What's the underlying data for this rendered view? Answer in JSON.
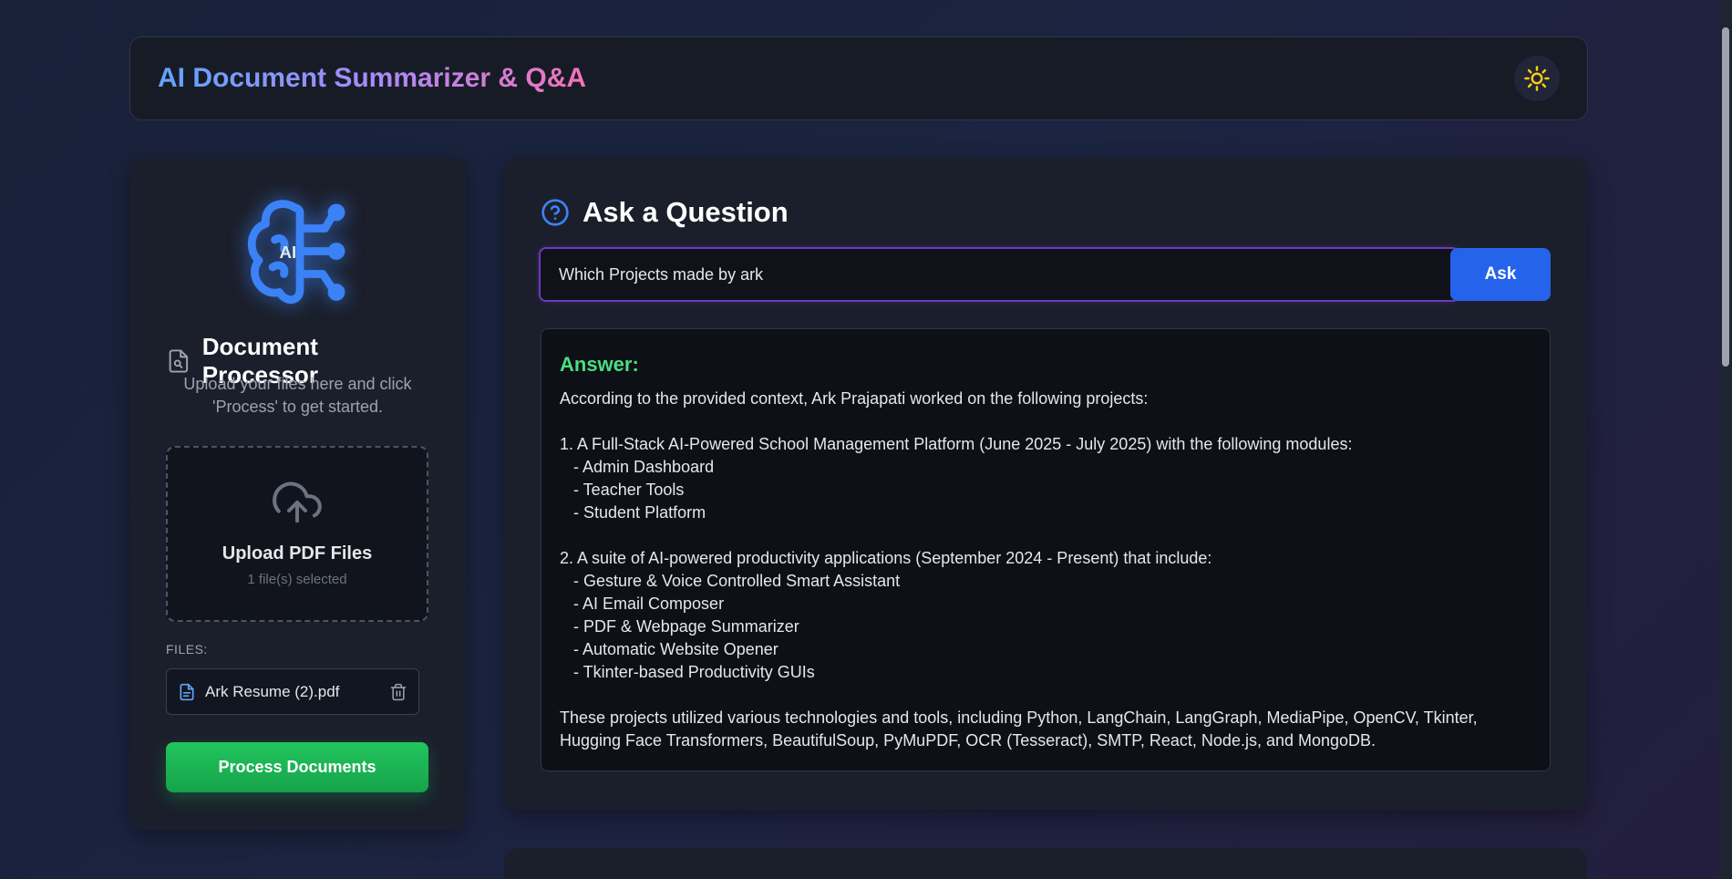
{
  "header": {
    "title": "AI Document Summarizer & Q&A",
    "theme_toggle_icon": "sun-icon"
  },
  "sidebar": {
    "logo_text": "AI",
    "title": "Document Processor",
    "description": "Upload your files here and click 'Process' to get started.",
    "upload": {
      "title": "Upload PDF Files",
      "count": "1 file(s) selected"
    },
    "files_label": "FILES:",
    "files": [
      {
        "name": "Ark Resume (2).pdf"
      }
    ],
    "process_label": "Process Documents"
  },
  "qa": {
    "title": "Ask a Question",
    "question_value": "Which Projects made by ark",
    "ask_label": "Ask",
    "answer_label": "Answer:",
    "answer_text": "According to the provided context, Ark Prajapati worked on the following projects:\n\n1. A Full-Stack AI-Powered School Management Platform (June 2025 - July 2025) with the following modules:\n   - Admin Dashboard\n   - Teacher Tools\n   - Student Platform\n\n2. A suite of AI-powered productivity applications (September 2024 - Present) that include:\n   - Gesture & Voice Controlled Smart Assistant\n   - AI Email Composer\n   - PDF & Webpage Summarizer\n   - Automatic Website Opener\n   - Tkinter-based Productivity GUIs\n\nThese projects utilized various technologies and tools, including Python, LangChain, LangGraph, MediaPipe, OpenCV, Tkinter, Hugging Face Transformers, BeautifulSoup, PyMuPDF, OCR (Tesseract), SMTP, React, Node.js, and MongoDB."
  },
  "colors": {
    "accent_blue": "#2563eb",
    "answer_green": "#4ade80",
    "process_green": "#22c55e",
    "input_border_purple": "#6d3bb8"
  }
}
